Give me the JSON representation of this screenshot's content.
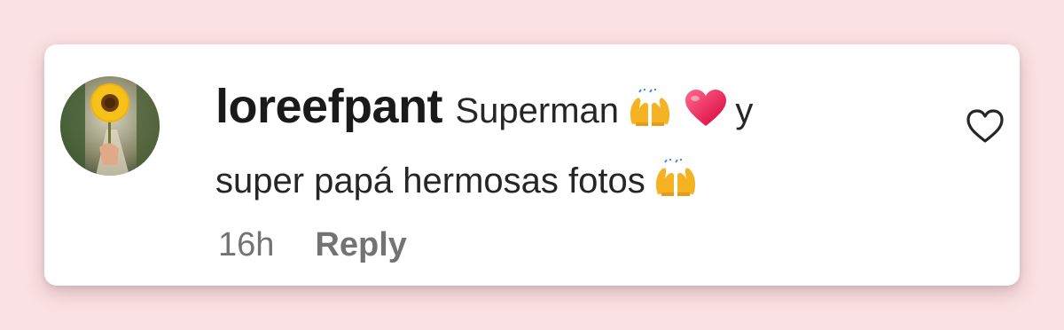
{
  "comment": {
    "username": "loreefpant",
    "text_segments": [
      "Superman",
      "y",
      "super papá hermosas fotos"
    ],
    "emojis": [
      "raising-hands-icon",
      "heart-icon",
      "raising-hands-icon"
    ],
    "time": "16h",
    "reply_label": "Reply"
  },
  "colors": {
    "background": "#fbe1e3",
    "card": "#ffffff",
    "text": "#262626",
    "meta": "#737373"
  }
}
